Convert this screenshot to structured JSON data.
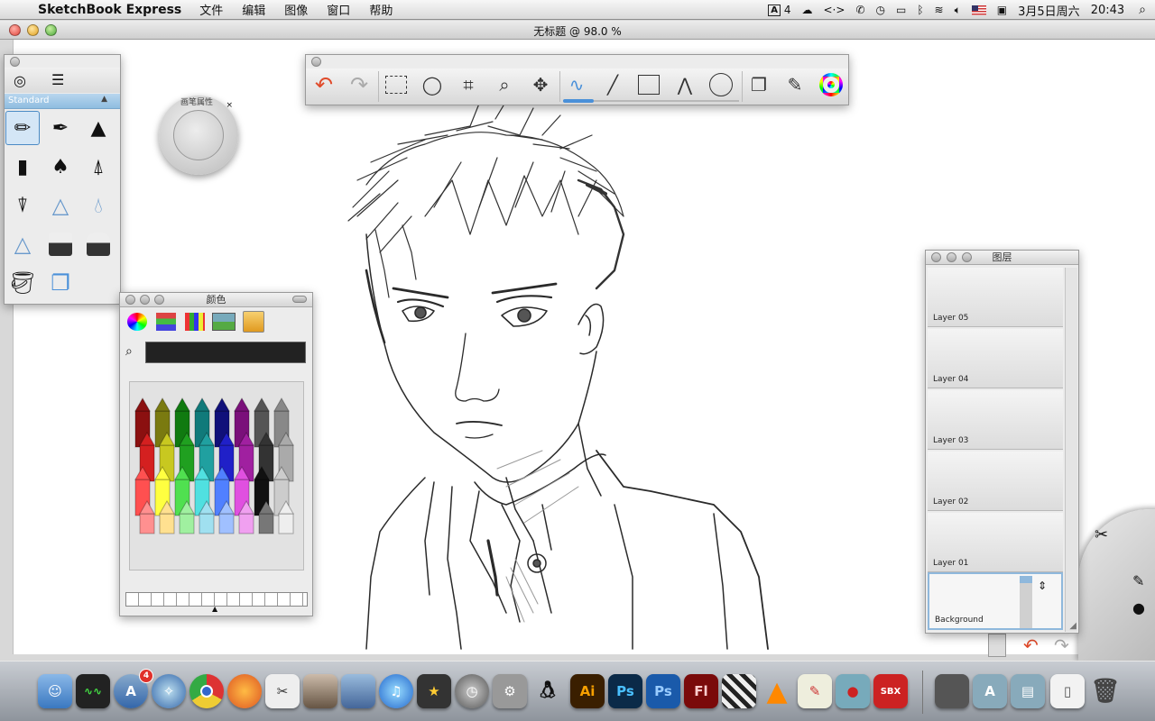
{
  "menubar": {
    "app_name": "SketchBook Express",
    "items": [
      "文件",
      "编辑",
      "图像",
      "窗口",
      "帮助"
    ],
    "status": {
      "adobe": "4",
      "code": "<·>",
      "date": "3月5日周六",
      "time": "20:43"
    }
  },
  "window": {
    "title": "无标题 @ 98.0 %"
  },
  "brush_panel": {
    "section": "Standard"
  },
  "puck": {
    "label": "画笔属性"
  },
  "color_panel": {
    "title": "颜色"
  },
  "layers_panel": {
    "title": "图层",
    "layers": [
      "Layer 05",
      "Layer 04",
      "Layer 03",
      "Layer 02",
      "Layer 01"
    ],
    "background": "Background"
  },
  "dock": {
    "appstore_badge": "4",
    "ai": "Ai",
    "ps": "Ps",
    "ps2": "Ps",
    "fl": "Fl",
    "sbx": "SBX"
  },
  "colors": {
    "accent": "#4a90d9",
    "undo": "#e04a2a",
    "canvas": "#ffffff"
  }
}
